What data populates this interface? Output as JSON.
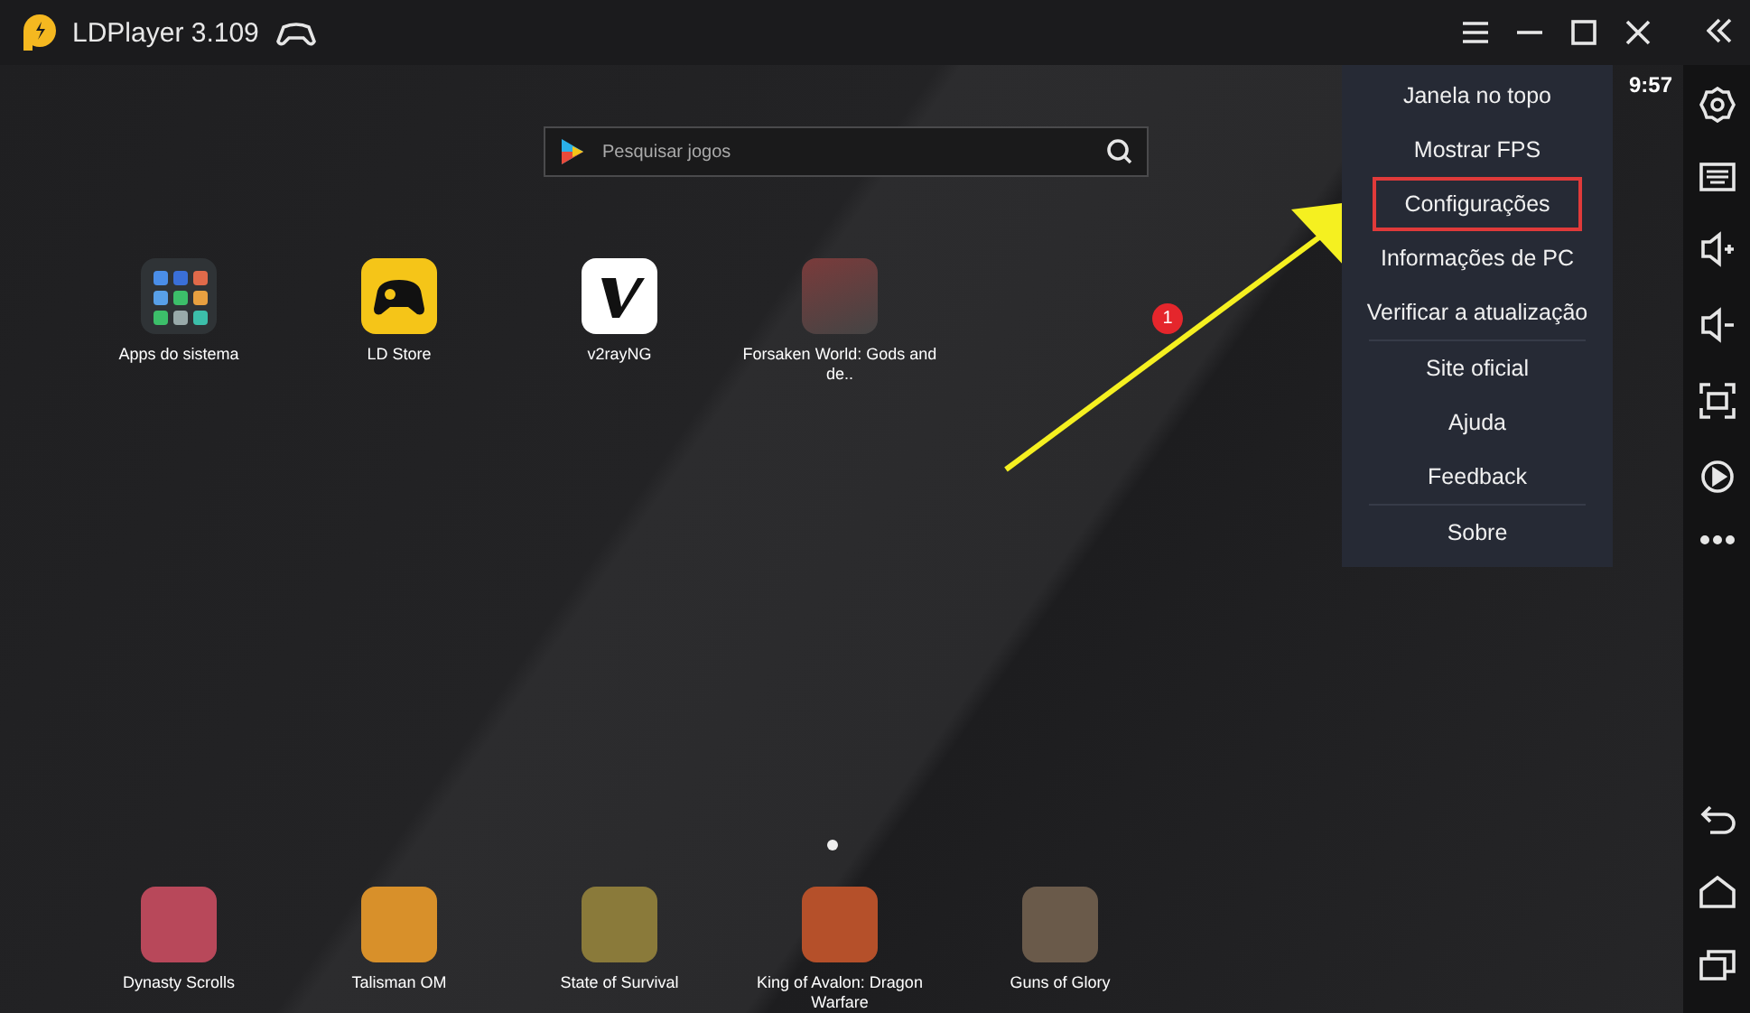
{
  "window": {
    "title": "LDPlayer 3.109"
  },
  "status_bar": {
    "time": "9:57"
  },
  "search": {
    "placeholder": "Pesquisar jogos"
  },
  "apps": [
    {
      "label": "Apps do sistema",
      "kind": "folder"
    },
    {
      "label": "LD Store",
      "kind": "store"
    },
    {
      "label": "v2rayNG",
      "kind": "v"
    },
    {
      "label": "Forsaken World: Gods and de..",
      "kind": "photo"
    }
  ],
  "dock": [
    {
      "label": "Dynasty Scrolls",
      "color": "#b8485a"
    },
    {
      "label": "Talisman OM",
      "color": "#d8902a"
    },
    {
      "label": "State of Survival",
      "color": "#8a7a3a"
    },
    {
      "label": "King of Avalon: Dragon Warfare",
      "color": "#b5502a"
    },
    {
      "label": "Guns of Glory",
      "color": "#6a5a4a"
    }
  ],
  "menu": [
    {
      "label": "Janela no topo",
      "highlighted": false,
      "divider_after": false
    },
    {
      "label": "Mostrar FPS",
      "highlighted": false,
      "divider_after": false
    },
    {
      "label": "Configurações",
      "highlighted": true,
      "divider_after": false
    },
    {
      "label": "Informações de PC",
      "highlighted": false,
      "divider_after": false
    },
    {
      "label": "Verificar a atualização",
      "highlighted": false,
      "divider_after": true
    },
    {
      "label": "Site oficial",
      "highlighted": false,
      "divider_after": false
    },
    {
      "label": "Ajuda",
      "highlighted": false,
      "divider_after": false
    },
    {
      "label": "Feedback",
      "highlighted": false,
      "divider_after": true
    },
    {
      "label": "Sobre",
      "highlighted": false,
      "divider_after": false
    }
  ],
  "annotation": {
    "badge": "1"
  }
}
